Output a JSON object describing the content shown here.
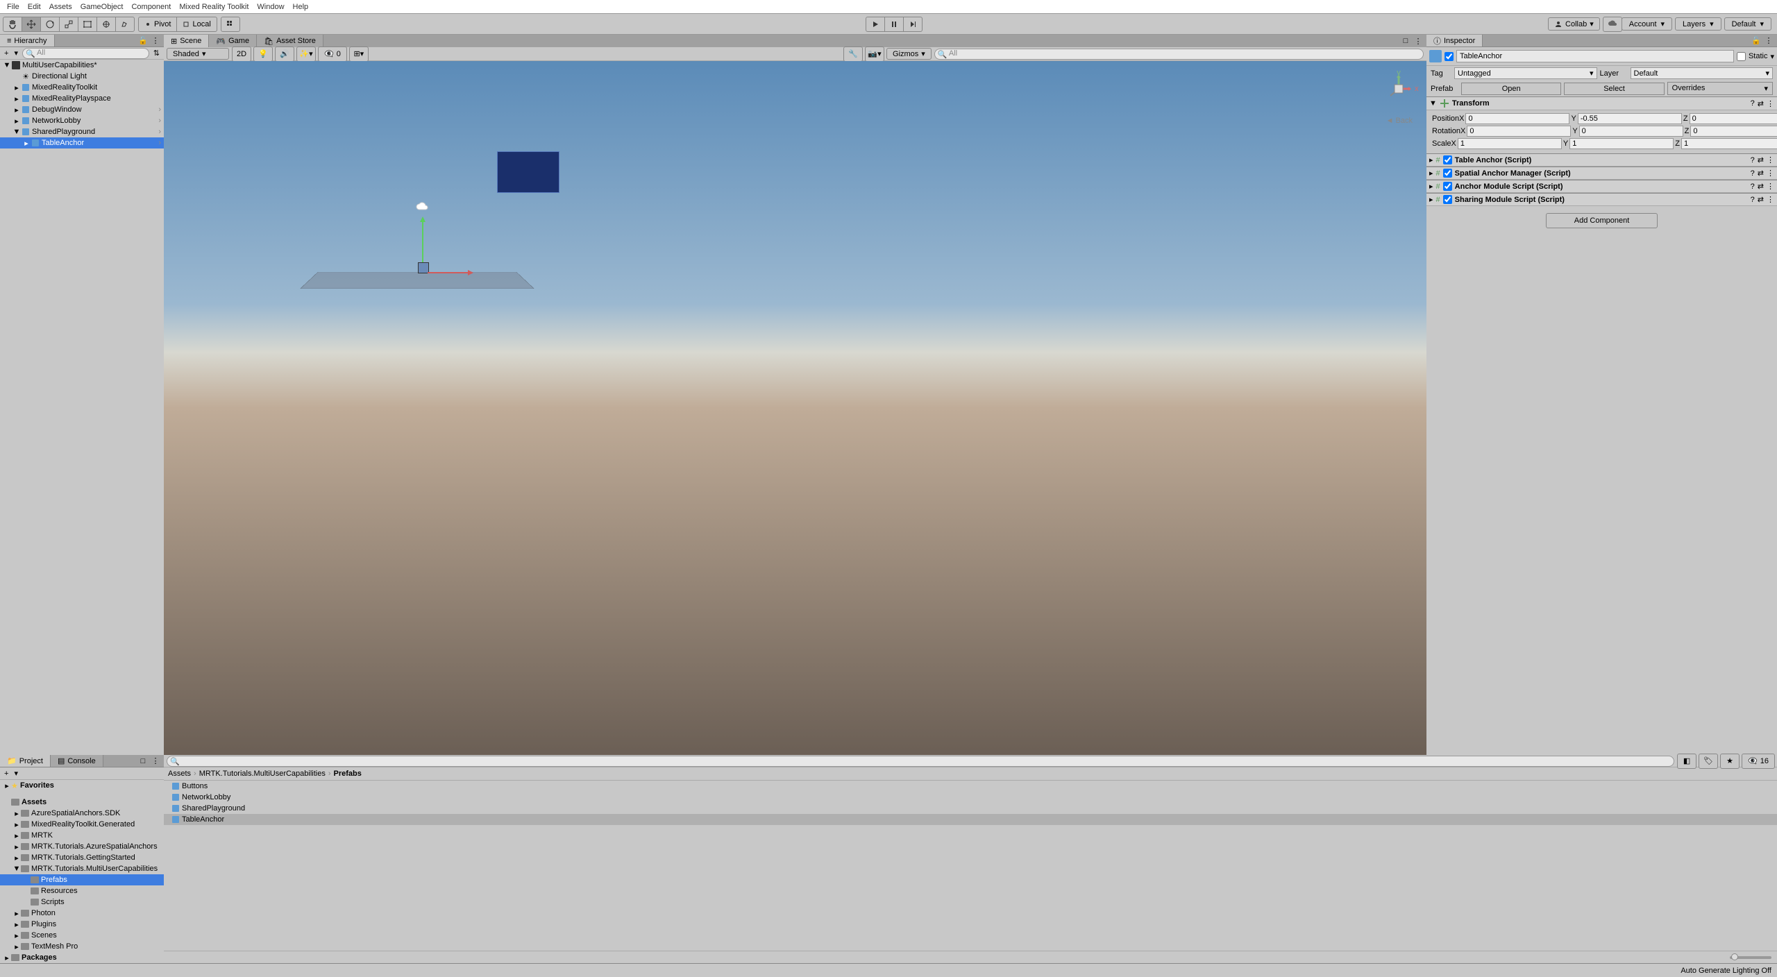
{
  "menubar": [
    "File",
    "Edit",
    "Assets",
    "GameObject",
    "Component",
    "Mixed Reality Toolkit",
    "Window",
    "Help"
  ],
  "toolbar": {
    "pivot": "Pivot",
    "local": "Local",
    "collab": "Collab",
    "account": "Account",
    "layers": "Layers",
    "layout": "Default"
  },
  "hierarchy": {
    "title": "Hierarchy",
    "search_placeholder": "All",
    "items": [
      {
        "name": "MultiUserCapabilities*",
        "depth": 0,
        "icon": "unity",
        "expanded": true,
        "hasChildren": true
      },
      {
        "name": "Directional Light",
        "depth": 1,
        "icon": "light"
      },
      {
        "name": "MixedRealityToolkit",
        "depth": 1,
        "icon": "prefab",
        "hasChildren": true
      },
      {
        "name": "MixedRealityPlayspace",
        "depth": 1,
        "icon": "prefab",
        "hasChildren": true
      },
      {
        "name": "DebugWindow",
        "depth": 1,
        "icon": "prefab",
        "hasChildren": true,
        "sub": true
      },
      {
        "name": "NetworkLobby",
        "depth": 1,
        "icon": "prefab",
        "hasChildren": true,
        "sub": true
      },
      {
        "name": "SharedPlayground",
        "depth": 1,
        "icon": "prefab",
        "hasChildren": true,
        "sub": true,
        "expanded": true
      },
      {
        "name": "TableAnchor",
        "depth": 2,
        "icon": "prefab",
        "hasChildren": true,
        "sub": true,
        "selected": true
      }
    ]
  },
  "scene_tabs": [
    {
      "label": "Scene",
      "active": true
    },
    {
      "label": "Game",
      "active": false
    },
    {
      "label": "Asset Store",
      "active": false
    }
  ],
  "scene_toolbar": {
    "shading": "Shaded",
    "mode2d": "2D",
    "hidden_count": "0",
    "gizmos": "Gizmos",
    "search_placeholder": "All",
    "back": "Back"
  },
  "inspector": {
    "title": "Inspector",
    "name": "TableAnchor",
    "static": "Static",
    "tag_label": "Tag",
    "tag": "Untagged",
    "layer_label": "Layer",
    "layer": "Default",
    "prefab_label": "Prefab",
    "open": "Open",
    "select": "Select",
    "overrides": "Overrides",
    "transform": {
      "title": "Transform",
      "position": {
        "label": "Position",
        "x": "0",
        "y": "-0.55",
        "z": "0"
      },
      "rotation": {
        "label": "Rotation",
        "x": "0",
        "y": "0",
        "z": "0"
      },
      "scale": {
        "label": "Scale",
        "x": "1",
        "y": "1",
        "z": "1"
      }
    },
    "components": [
      "Table Anchor (Script)",
      "Spatial Anchor Manager (Script)",
      "Anchor Module Script (Script)",
      "Sharing Module Script (Script)"
    ],
    "add_component": "Add Component"
  },
  "project": {
    "title": "Project",
    "console": "Console",
    "favorites": "Favorites",
    "count": "16",
    "tree": [
      {
        "name": "Assets",
        "depth": 0,
        "expanded": true
      },
      {
        "name": "AzureSpatialAnchors.SDK",
        "depth": 1,
        "hasChildren": true
      },
      {
        "name": "MixedRealityToolkit.Generated",
        "depth": 1,
        "hasChildren": true
      },
      {
        "name": "MRTK",
        "depth": 1,
        "hasChildren": true
      },
      {
        "name": "MRTK.Tutorials.AzureSpatialAnchors",
        "depth": 1,
        "hasChildren": true
      },
      {
        "name": "MRTK.Tutorials.GettingStarted",
        "depth": 1,
        "hasChildren": true
      },
      {
        "name": "MRTK.Tutorials.MultiUserCapabilities",
        "depth": 1,
        "expanded": true,
        "hasChildren": true
      },
      {
        "name": "Prefabs",
        "depth": 2,
        "selected": true
      },
      {
        "name": "Resources",
        "depth": 2
      },
      {
        "name": "Scripts",
        "depth": 2
      },
      {
        "name": "Photon",
        "depth": 1,
        "hasChildren": true
      },
      {
        "name": "Plugins",
        "depth": 1,
        "hasChildren": true
      },
      {
        "name": "Scenes",
        "depth": 1,
        "hasChildren": true
      },
      {
        "name": "TextMesh Pro",
        "depth": 1,
        "hasChildren": true
      },
      {
        "name": "Packages",
        "depth": 0,
        "hasChildren": true
      }
    ],
    "breadcrumb": [
      "Assets",
      "MRTK.Tutorials.MultiUserCapabilities",
      "Prefabs"
    ],
    "assets": [
      {
        "name": "Buttons"
      },
      {
        "name": "NetworkLobby"
      },
      {
        "name": "SharedPlayground"
      },
      {
        "name": "TableAnchor",
        "selected": true
      }
    ]
  },
  "statusbar": {
    "lighting": "Auto Generate Lighting Off"
  }
}
